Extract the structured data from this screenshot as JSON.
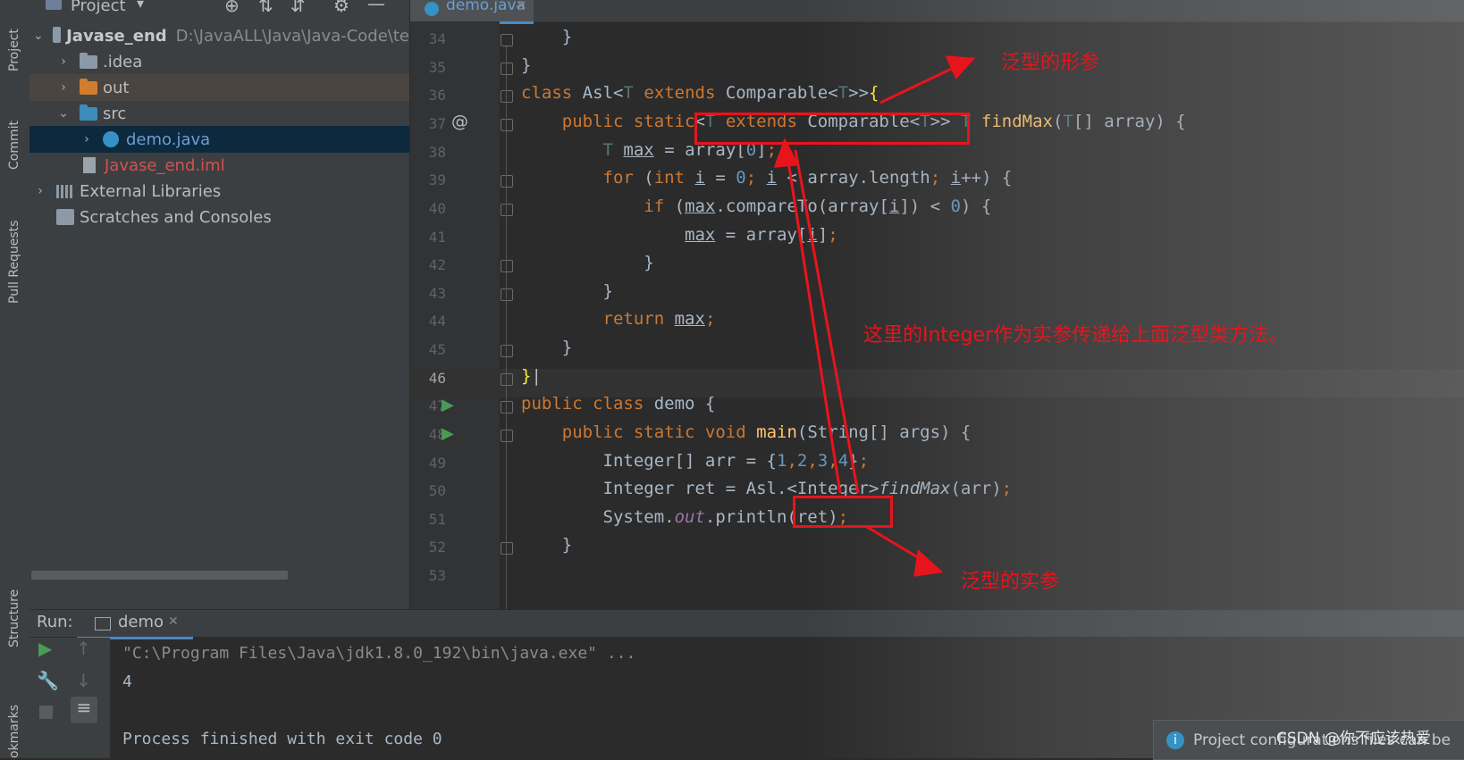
{
  "side_tabs": {
    "project": "Project",
    "commit": "Commit",
    "pull_requests": "Pull Requests",
    "structure": "Structure",
    "bookmarks": "okmarks"
  },
  "project_panel": {
    "title": "Project",
    "tree": [
      {
        "label": "Javase_end",
        "path": "D:\\JavaALL\\Java\\Java-Code\\te"
      },
      {
        "label": ".idea"
      },
      {
        "label": "out"
      },
      {
        "label": "src"
      },
      {
        "label": "demo.java"
      },
      {
        "label": "Javase_end.iml"
      },
      {
        "label": "External Libraries"
      },
      {
        "label": "Scratches and Consoles"
      }
    ]
  },
  "editor": {
    "tab": "demo.java",
    "line_numbers": [
      "34",
      "35",
      "36",
      "37",
      "38",
      "39",
      "40",
      "41",
      "42",
      "43",
      "44",
      "45",
      "46",
      "47",
      "48",
      "49",
      "50",
      "51",
      "52",
      "53"
    ],
    "gutter_at": "@"
  },
  "run_panel": {
    "label": "Run:",
    "tab": "demo",
    "output": [
      "\"C:\\Program Files\\Java\\jdk1.8.0_192\\bin\\java.exe\" ...",
      "4",
      "",
      "Process finished with exit code 0"
    ]
  },
  "annotations": {
    "formal": "泛型的形参",
    "actual": "泛型的实参",
    "explain": "这里的Integer作为实参传递给上面泛型类方法。"
  },
  "notification": "Project configurations files can be",
  "watermark": "CSDN @你不应该热爱",
  "colors": {
    "annotation": "#e8141c",
    "keyword": "#cc7832",
    "function": "#ffc66d",
    "number": "#6897bb"
  }
}
